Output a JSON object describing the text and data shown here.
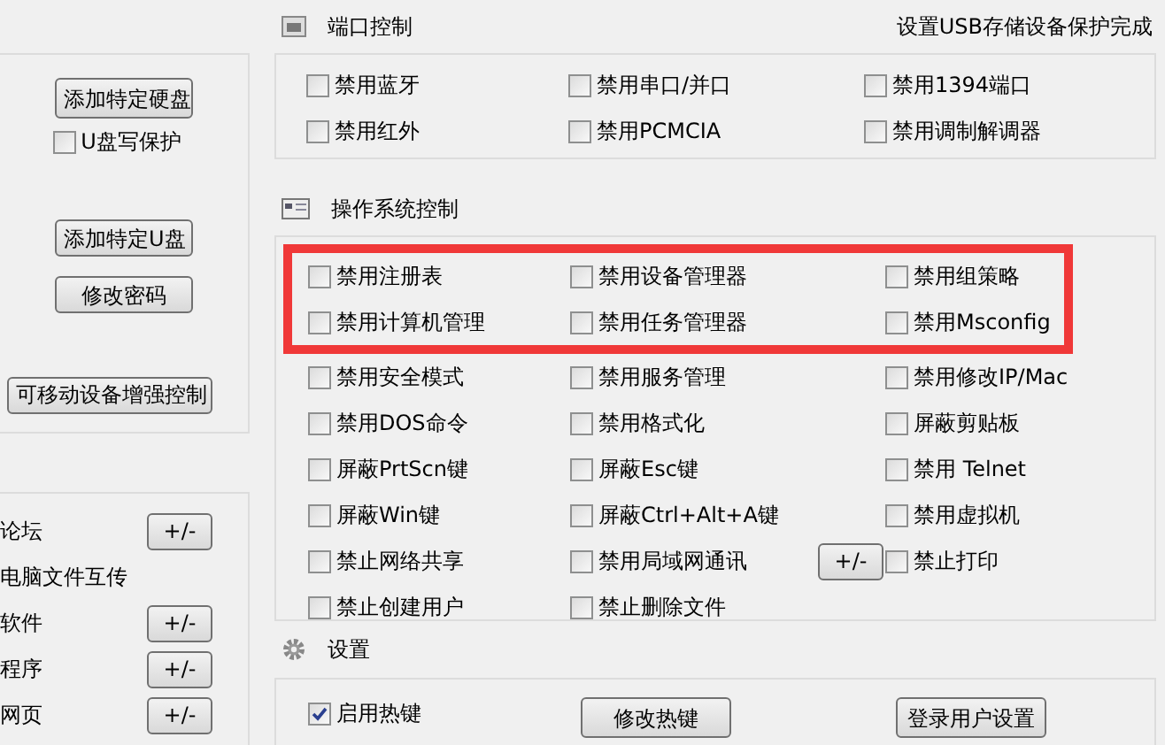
{
  "left_panel": {
    "buttons_top": [
      {
        "label": "添加特定硬盘"
      }
    ],
    "write_protect": {
      "label": "U盘写保护",
      "checked": false
    },
    "buttons_mid": [
      {
        "label": "添加特定U盘"
      },
      {
        "label": "修改密码"
      }
    ],
    "enhanced_button": {
      "label": "可移动设备增强控制"
    }
  },
  "left_list": [
    {
      "label": "论坛",
      "button": "+/-"
    },
    {
      "label": "电脑文件互传"
    },
    {
      "label": "软件",
      "button": "+/-"
    },
    {
      "label": "程序",
      "button": "+/-"
    },
    {
      "label": "网页",
      "button": "+/-"
    }
  ],
  "status": "设置USB存储设备保护完成",
  "port_control": {
    "title": "端口控制",
    "rows": [
      [
        {
          "label": "禁用蓝牙",
          "checked": false
        },
        {
          "label": "禁用串口/并口",
          "checked": false
        },
        {
          "label": "禁用1394端口",
          "checked": false
        }
      ],
      [
        {
          "label": "禁用红外",
          "checked": false
        },
        {
          "label": "禁用PCMCIA",
          "checked": false
        },
        {
          "label": "禁用调制解调器",
          "checked": false
        }
      ]
    ]
  },
  "os_control": {
    "title": "操作系统控制",
    "rows": [
      {
        "highlighted": true,
        "items": [
          {
            "label": "禁用注册表",
            "checked": false
          },
          {
            "label": "禁用设备管理器",
            "checked": false
          },
          {
            "label": "禁用组策略",
            "checked": false
          }
        ]
      },
      {
        "highlighted": true,
        "items": [
          {
            "label": "禁用计算机管理",
            "checked": false
          },
          {
            "label": "禁用任务管理器",
            "checked": false
          },
          {
            "label": "禁用Msconfig",
            "checked": false
          }
        ]
      },
      {
        "highlighted": false,
        "items": [
          {
            "label": "禁用安全模式",
            "checked": false
          },
          {
            "label": "禁用服务管理",
            "checked": false
          },
          {
            "label": "禁用修改IP/Mac",
            "checked": false
          }
        ]
      },
      {
        "highlighted": false,
        "items": [
          {
            "label": "禁用DOS命令",
            "checked": false
          },
          {
            "label": "禁用格式化",
            "checked": false
          },
          {
            "label": "屏蔽剪贴板",
            "checked": false
          }
        ]
      },
      {
        "highlighted": false,
        "items": [
          {
            "label": "屏蔽PrtScn键",
            "checked": false
          },
          {
            "label": "屏蔽Esc键",
            "checked": false
          },
          {
            "label": "禁用 Telnet",
            "checked": false
          }
        ]
      },
      {
        "highlighted": false,
        "items": [
          {
            "label": "屏蔽Win键",
            "checked": false
          },
          {
            "label": "屏蔽Ctrl+Alt+A键",
            "checked": false
          },
          {
            "label": "禁用虚拟机",
            "checked": false
          }
        ]
      },
      {
        "highlighted": false,
        "items": [
          {
            "label": "禁止网络共享",
            "checked": false
          },
          {
            "label": "禁用局域网通讯",
            "checked": false,
            "button": "+/-"
          },
          {
            "label": "禁止打印",
            "checked": false
          }
        ]
      },
      {
        "highlighted": false,
        "items": [
          {
            "label": "禁止创建用户",
            "checked": false
          },
          {
            "label": "禁止删除文件",
            "checked": false
          }
        ]
      }
    ]
  },
  "settings": {
    "title": "设置",
    "hotkey": {
      "label": "启用热键",
      "checked": true
    },
    "buttons": [
      {
        "label": "修改热键"
      },
      {
        "label": "登录用户设置"
      }
    ]
  }
}
